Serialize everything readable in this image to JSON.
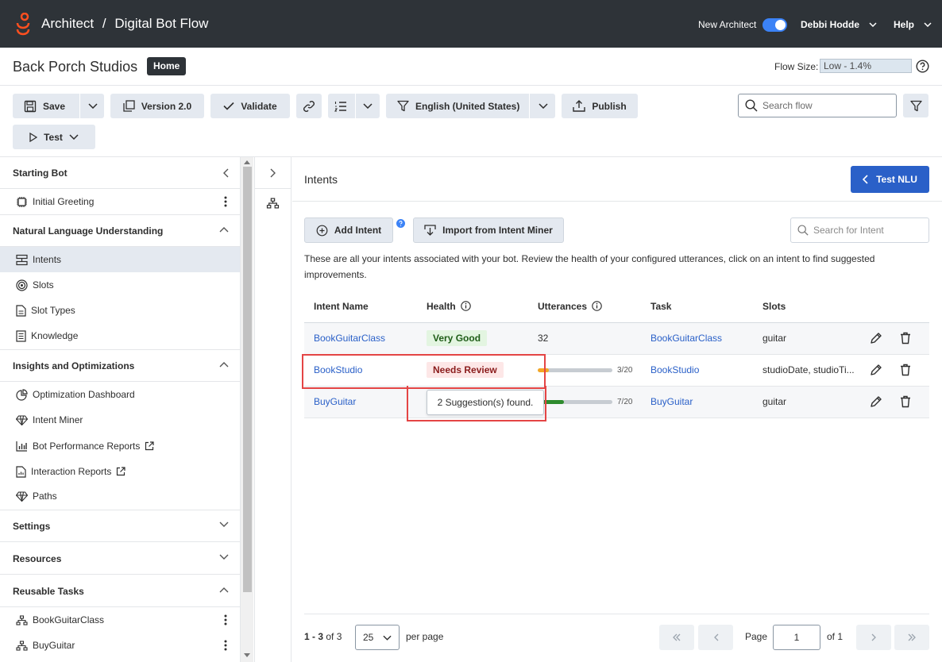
{
  "app": {
    "breadcrumb_app": "Architect",
    "breadcrumb_sep": "/",
    "breadcrumb_flow": "Digital Bot Flow",
    "new_architect_label": "New Architect",
    "user_name": "Debbi Hodde",
    "help_label": "Help"
  },
  "header": {
    "studio_name": "Back Porch Studios",
    "home_badge": "Home",
    "flow_size_label": "Flow Size:",
    "flow_size_value": "Low - 1.4%"
  },
  "toolbar": {
    "save": "Save",
    "version": "Version 2.0",
    "validate": "Validate",
    "language": "English (United States)",
    "publish": "Publish",
    "test": "Test",
    "search_placeholder": "Search flow"
  },
  "sidebar": {
    "starting_bot": "Starting Bot",
    "initial_greeting": "Initial Greeting",
    "nlu": "Natural Language Understanding",
    "nlu_items": [
      "Intents",
      "Slots",
      "Slot Types",
      "Knowledge"
    ],
    "insights": "Insights and Optimizations",
    "insight_items": [
      "Optimization Dashboard",
      "Intent Miner",
      "Bot Performance Reports",
      "Interaction Reports",
      "Paths"
    ],
    "settings": "Settings",
    "resources": "Resources",
    "reusable_tasks": "Reusable Tasks",
    "task_items": [
      "BookGuitarClass",
      "BuyGuitar"
    ]
  },
  "main": {
    "title": "Intents",
    "test_nlu": "Test NLU",
    "add_intent": "Add Intent",
    "import_miner": "Import from Intent Miner",
    "search_placeholder": "Search for Intent",
    "description": "These are all your intents associated with your bot. Review the health of your configured utterances, click on an intent to find suggested improvements.",
    "columns": [
      "Intent Name",
      "Health",
      "Utterances",
      "Task",
      "Slots"
    ],
    "rows": [
      {
        "name": "BookGuitarClass",
        "health": "Very Good",
        "utterances": "32",
        "task": "BookGuitarClass",
        "slots": "guitar"
      },
      {
        "name": "BookStudio",
        "health": "Needs Review",
        "utterances": "3/20",
        "utter_fill": 0.15,
        "task": "BookStudio",
        "slots": "studioDate, studioTi..."
      },
      {
        "name": "BuyGuitar",
        "health": "",
        "utterances": "7/20",
        "utter_fill": 0.35,
        "task": "BuyGuitar",
        "slots": "guitar"
      }
    ],
    "tooltip": "2 Suggestion(s) found.",
    "pager": {
      "range": "1 - 3",
      "of_total": "of 3",
      "per_page_value": "25",
      "per_page_label": "per page",
      "page_label": "Page",
      "page_value": "1",
      "of_pages": "of 1"
    }
  },
  "colors": {
    "topbar": "#2e3338",
    "accent": "#2a60c8",
    "logo": "#ff4f1f",
    "bar_orange": "#f5a623",
    "bar_green": "#2e8b2e",
    "highlight": "#e44545"
  }
}
